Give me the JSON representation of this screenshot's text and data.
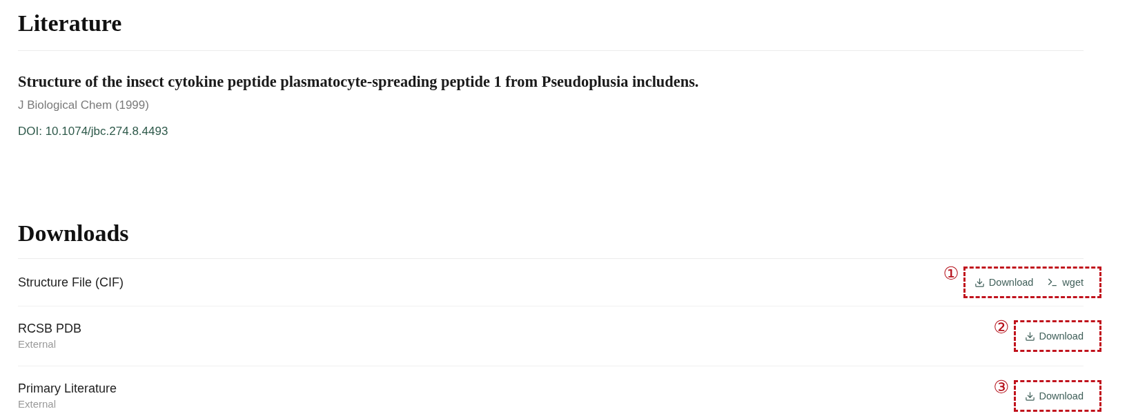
{
  "literature": {
    "heading": "Literature",
    "title": "Structure of the insect cytokine peptide plasmatocyte-spreading peptide 1 from Pseudoplusia includens.",
    "journal": "J Biological Chem (1999)",
    "doi": "DOI: 10.1074/jbc.274.8.4493"
  },
  "downloads": {
    "heading": "Downloads",
    "rows": [
      {
        "name": "Structure File (CIF)",
        "actions": [
          {
            "kind": "download",
            "label": "Download"
          },
          {
            "kind": "wget",
            "label": "wget"
          }
        ],
        "annotation": {
          "marker": "①"
        }
      },
      {
        "name": "RCSB PDB",
        "note": "External",
        "actions": [
          {
            "kind": "download",
            "label": "Download"
          }
        ],
        "annotation": {
          "marker": "②"
        }
      },
      {
        "name": "Primary Literature",
        "note": "External",
        "actions": [
          {
            "kind": "download",
            "label": "Download"
          }
        ],
        "annotation": {
          "marker": "③"
        }
      }
    ]
  }
}
